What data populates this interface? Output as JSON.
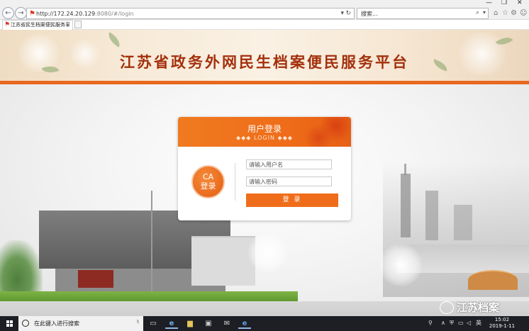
{
  "browser": {
    "url_host": "http://172.24.20.129",
    "url_rest": ":8080/#/login",
    "search_placeholder": "搜索...",
    "tab_title": "江苏省民生档案便民服务平",
    "tab_close": "×",
    "window_controls": [
      "—",
      "❐",
      "✕"
    ]
  },
  "page": {
    "site_title": "江苏省政务外网民生档案便民服务平台",
    "login": {
      "heading": "用户登录",
      "subheading": "◆◆◆ LOGIN ◆◆◆",
      "ca_line1": "CA",
      "ca_line2": "登录",
      "username_placeholder": "请输入用户名",
      "password_placeholder": "请输入密码",
      "submit_label": "登 录"
    }
  },
  "taskbar": {
    "search_placeholder": "在此键入进行搜索",
    "ime_label": "英",
    "time": "15:02",
    "date": "2019-1-11"
  },
  "watermark": {
    "text": "江苏档案"
  },
  "colors": {
    "accent": "#ef6d1a",
    "title": "#a3300c",
    "taskbar": "#1d1f25"
  }
}
